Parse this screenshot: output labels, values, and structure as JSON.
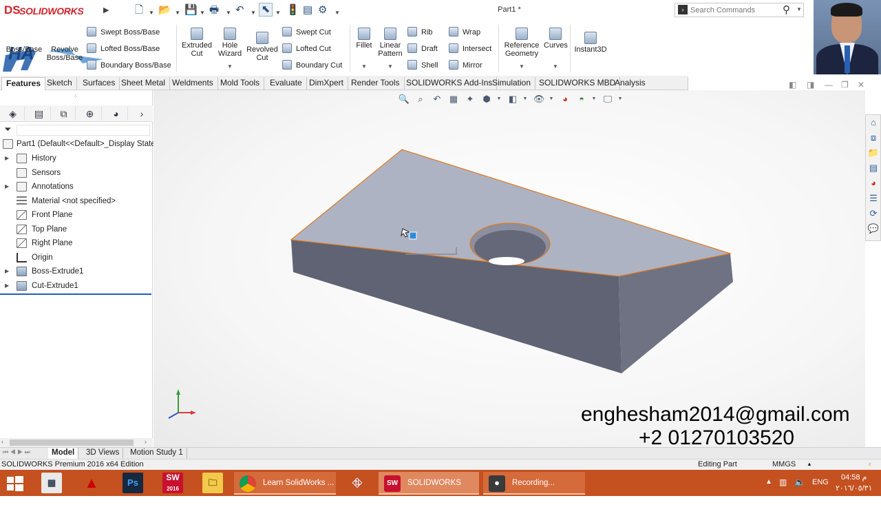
{
  "app": {
    "brand": "SOLIDWORKS",
    "doc_title": "Part1 *",
    "search_placeholder": "Search Commands"
  },
  "watermark_text": "HA",
  "ribbon": {
    "extruded_boss_label": "Boss/Base",
    "revolved_boss_label": "Revolve Boss/Base",
    "swept_boss": "Swept Boss/Base",
    "lofted_boss": "Lofted Boss/Base",
    "boundary_boss": "Boundary Boss/Base",
    "extruded_cut": "Extruded Cut",
    "hole_wizard": "Hole Wizard",
    "revolved_cut": "Revolved Cut",
    "swept_cut": "Swept Cut",
    "lofted_cut": "Lofted Cut",
    "boundary_cut": "Boundary Cut",
    "fillet": "Fillet",
    "linear_pattern": "Linear Pattern",
    "rib": "Rib",
    "draft": "Draft",
    "shell": "Shell",
    "wrap": "Wrap",
    "intersect": "Intersect",
    "mirror": "Mirror",
    "reference_geometry": "Reference Geometry",
    "curves": "Curves",
    "instant3d": "Instant3D"
  },
  "tabs": [
    "Features",
    "Sketch",
    "Surfaces",
    "Sheet Metal",
    "Weldments",
    "Mold Tools",
    "Evaluate",
    "DimXpert",
    "Render Tools",
    "SOLIDWORKS Add-Ins",
    "Simulation",
    "SOLIDWORKS MBD",
    "Analysis Preparation"
  ],
  "tree": {
    "root": "Part1  (Default<<Default>_Display State",
    "items": [
      "History",
      "Sensors",
      "Annotations",
      "Material <not specified>",
      "Front Plane",
      "Top Plane",
      "Right Plane",
      "Origin",
      "Boss-Extrude1",
      "Cut-Extrude1"
    ]
  },
  "bottom_tabs": [
    "Model",
    "3D Views",
    "Motion Study 1"
  ],
  "status": {
    "left": "SOLIDWORKS Premium 2016 x64 Edition",
    "editing": "Editing Part",
    "units": "MMGS"
  },
  "contact": {
    "email": "enghesham2014@gmail.com",
    "phone": "+2 01270103520"
  },
  "taskbar": {
    "windows": [
      "Learn SolidWorks ...",
      "SOLIDWORKS Pre...",
      "Recording..."
    ],
    "sw_badge": "SW",
    "sw_year": "2016",
    "ps_label": "Ps",
    "lang": "ENG",
    "time": "04:58 م",
    "date": "٢٠١٦/٠٥/٣١"
  },
  "colors": {
    "brand_red": "#d2232a",
    "taskbar": "#c4511f",
    "model_face": "#aeb3c3",
    "model_edge": "#e07a1f",
    "tree_underline": "#1f5fb5"
  }
}
